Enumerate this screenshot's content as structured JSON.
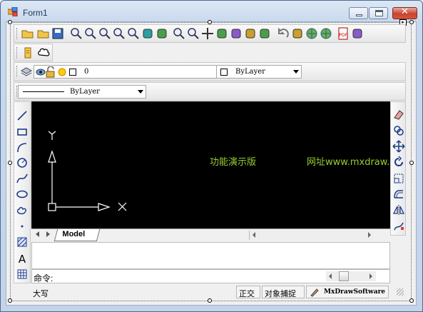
{
  "window": {
    "title": "Form1",
    "minimize_symbol": "",
    "maximize_symbol": "",
    "close_symbol": "✕"
  },
  "toolbar_main": {
    "icons": [
      "open-icon",
      "open-folder-icon",
      "save-icon",
      "zoom-window-icon",
      "zoom-realtime-icon",
      "zoom-in-icon",
      "zoom-out-icon",
      "zoom-extents-icon",
      "light-bulb-icon",
      "hammer-icon",
      "zoom-previous-icon",
      "zoom-magnify-icon",
      "pan-icon",
      "pencil-icon",
      "palette-icon",
      "layers-stack-icon",
      "brush-icon",
      "undo-icon",
      "copy-icon",
      "globe-icon",
      "globe-refresh-icon",
      "pdf-icon",
      "image-export-icon"
    ]
  },
  "toolbar_second": {
    "icons": [
      "bookmark-icon",
      "cloud-shape-icon"
    ]
  },
  "layer_bar": {
    "layer_value": "0",
    "color_value": "ByLayer",
    "linetype_value": "ByLayer"
  },
  "canvas": {
    "background": "#000000",
    "text_primary": "功能演示版",
    "text_secondary": "网址www.mxdraw.com",
    "text_color": "#9acd32"
  },
  "tabs": {
    "active": "Model"
  },
  "command": {
    "prompt": "命令:"
  },
  "status": {
    "caps": "大写",
    "ortho": "正交",
    "osnap": "对象捕捉",
    "brand": "MxDrawSoftware"
  },
  "left_tools": [
    "line-icon",
    "rectangle-icon",
    "arc-icon",
    "circle-icon",
    "spline-icon",
    "ellipse-icon",
    "revision-cloud-icon",
    "point-icon",
    "hatch-icon",
    "text-icon",
    "table-icon"
  ],
  "right_tools": [
    "erase-icon",
    "copy-objects-icon",
    "move-icon",
    "rotate-icon",
    "scale-icon",
    "offset-icon",
    "mirror-icon",
    "stretch-icon"
  ]
}
